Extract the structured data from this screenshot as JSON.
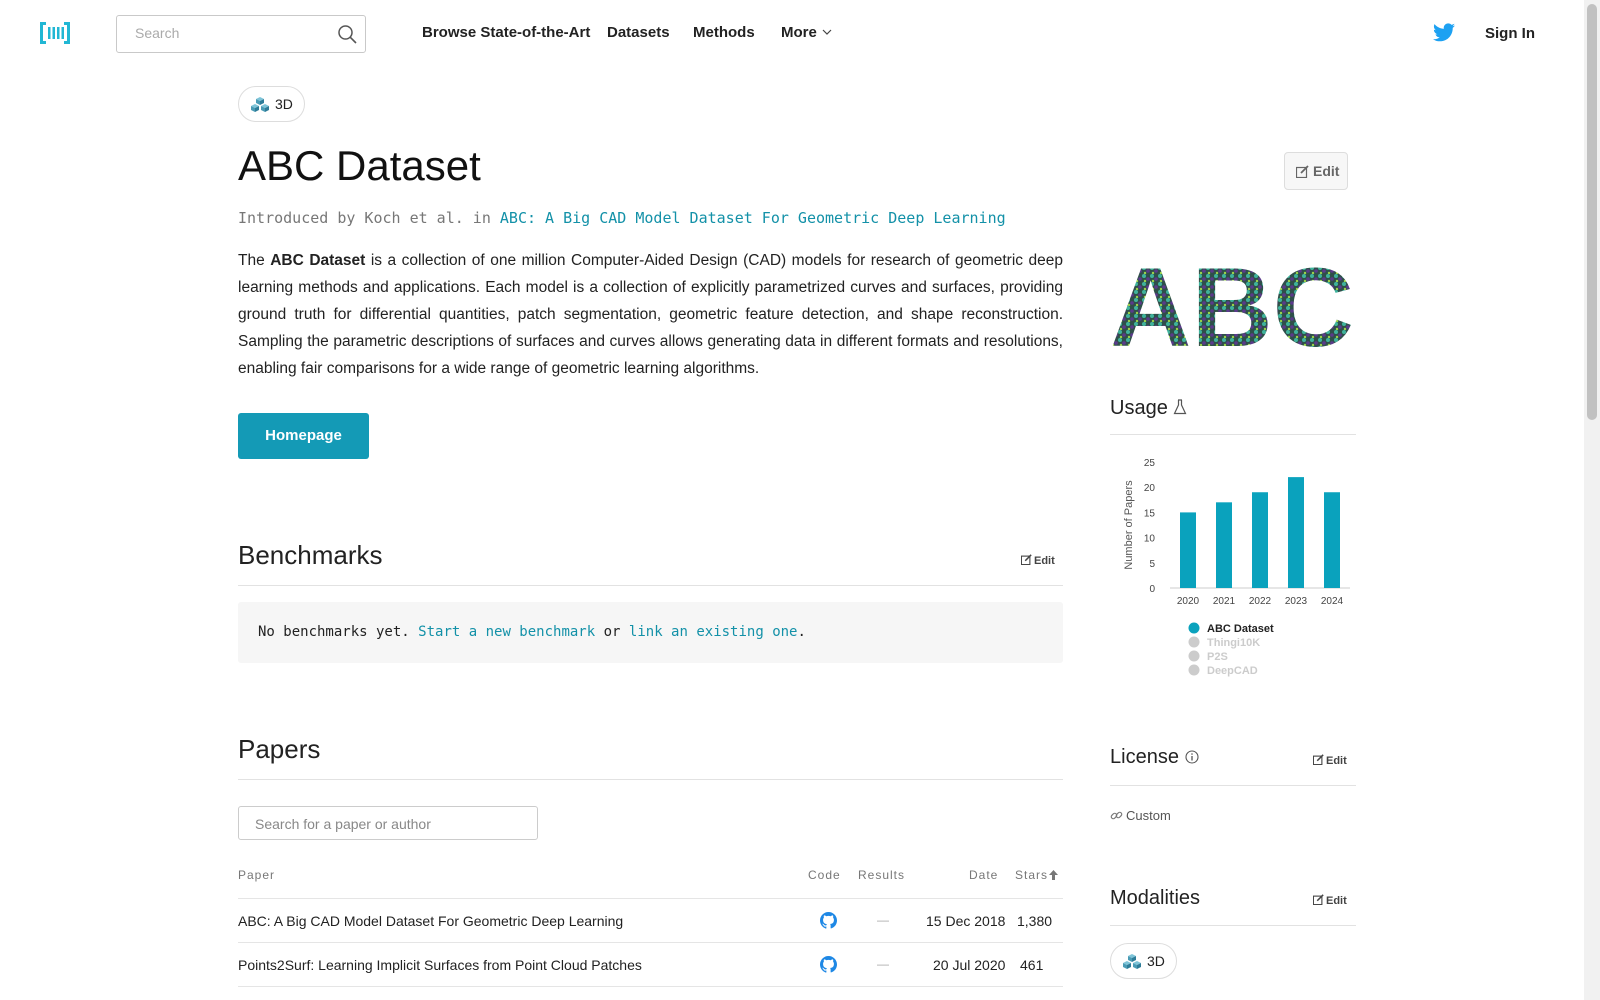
{
  "navbar": {
    "search_placeholder": "Search",
    "links": [
      "Browse State-of-the-Art",
      "Datasets",
      "Methods",
      "More"
    ],
    "sign_in": "Sign In",
    "icons": [
      "logo-icon",
      "search-icon",
      "chevron-down-icon",
      "twitter-icon"
    ]
  },
  "tag": {
    "label": "3D",
    "icon": "3d-cubes-icon"
  },
  "dataset": {
    "title": "ABC Dataset",
    "edit": "Edit",
    "intro_prefix": "Introduced by Koch et al. in",
    "intro_paper": "ABC: A Big CAD Model Dataset For Geometric Deep Learning",
    "desc_the": "The",
    "desc_name": "ABC Dataset",
    "description": "is a collection of one million Computer-Aided Design (CAD) models for research of geometric deep learning methods and applications. Each model is a collection of explicitly parametrized curves and surfaces, providing ground truth for differential quantities, patch segmentation, geometric feature detection, and shape reconstruction. Sampling the parametric descriptions of surfaces and curves allows generating data in different formats and resolutions, enabling fair comparisons for a wide range of geometric learning algorithms.",
    "homepage": "Homepage"
  },
  "benchmarks": {
    "heading": "Benchmarks",
    "edit": "Edit",
    "empty_text": "No benchmarks yet.",
    "start_link": "Start a new benchmark",
    "or": "or",
    "link_existing": "link an existing one",
    "period": "."
  },
  "papers": {
    "heading": "Papers",
    "search_placeholder": "Search for a paper or author",
    "columns": [
      "Paper",
      "Code",
      "Results",
      "Date",
      "Stars"
    ],
    "rows": [
      {
        "title": "ABC: A Big CAD Model Dataset For Geometric Deep Learning",
        "results": "—",
        "date": "15 Dec 2018",
        "stars": "1,380"
      },
      {
        "title": "Points2Surf: Learning Implicit Surfaces from Point Cloud Patches",
        "results": "—",
        "date": "20 Jul 2020",
        "stars": "461"
      }
    ]
  },
  "sidebar": {
    "image_text": "ABC",
    "usage": "Usage",
    "license": {
      "heading": "License",
      "edit": "Edit",
      "value": "Custom"
    },
    "modalities": {
      "heading": "Modalities",
      "edit": "Edit",
      "tag": "3D"
    }
  },
  "colors": {
    "accent": "#149ab6",
    "link": "#1391a8",
    "bar": "#0aa2bd",
    "legend_inactive": "#cccccc"
  },
  "chart_data": {
    "type": "bar",
    "categories": [
      "2020",
      "2021",
      "2022",
      "2023",
      "2024"
    ],
    "series": [
      {
        "name": "ABC Dataset",
        "values": [
          15,
          17,
          19,
          22,
          19
        ],
        "active": true
      },
      {
        "name": "Thingi10K",
        "values": [],
        "active": false
      },
      {
        "name": "P2S",
        "values": [],
        "active": false
      },
      {
        "name": "DeepCAD",
        "values": [],
        "active": false
      }
    ],
    "ylabel": "Number of Papers",
    "yticks": [
      "0",
      "5",
      "10",
      "15",
      "20",
      "25"
    ],
    "ylim": [
      0,
      25
    ],
    "legend_position": "bottom"
  }
}
